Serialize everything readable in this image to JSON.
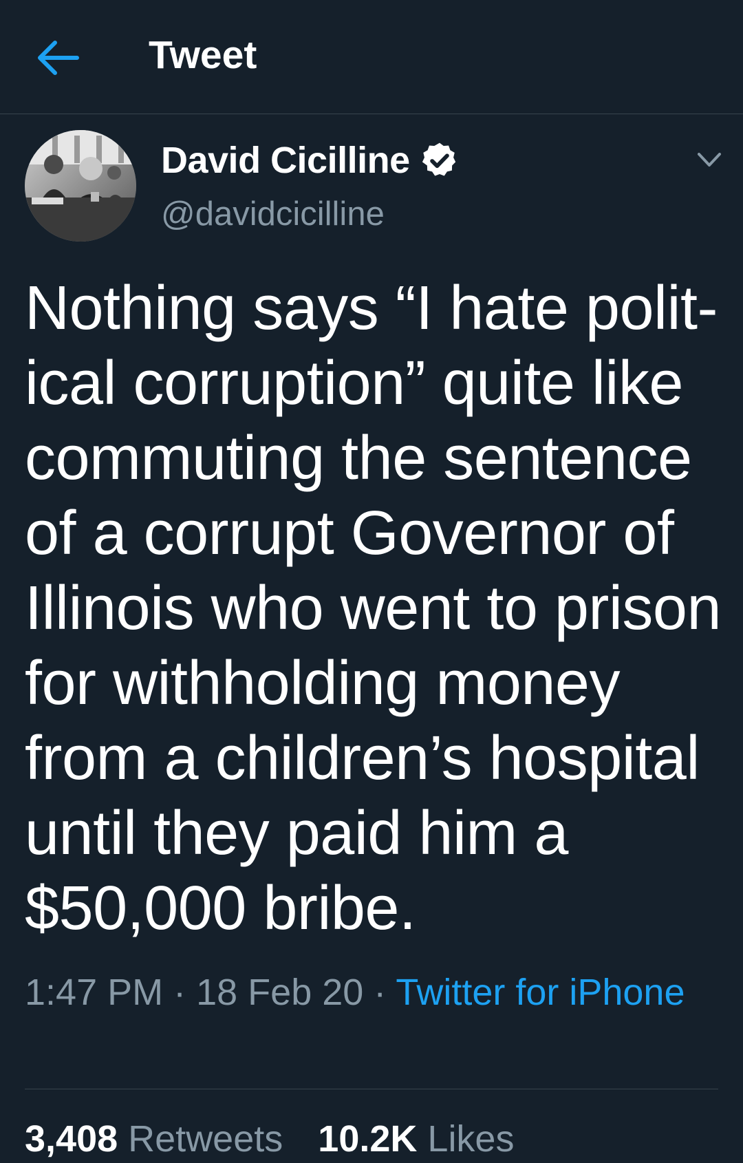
{
  "header": {
    "title": "Tweet",
    "back_icon": "arrow-left-icon"
  },
  "author": {
    "display_name": "David Cicilline",
    "handle": "@davidcicilline",
    "verified": true,
    "avatar_icon": "avatar-photo"
  },
  "tweet": {
    "text": "Nothing says “I hate polit-\nical corruption” quite like\ncommuting the sentence\nof a corrupt Governor of\nIllinois who went to prison\nfor withholding money\nfrom a children’s hospital\nuntil they paid him a\n$50,000 bribe.",
    "time": "1:47 PM",
    "date": "18 Feb 20",
    "separator": " · ",
    "source": "Twitter for iPhone"
  },
  "stats": {
    "retweets_count": "3,408",
    "retweets_label": "Retweets",
    "likes_count": "10.2K",
    "likes_label": "Likes"
  },
  "colors": {
    "background": "#15202b",
    "accent": "#1da1f2",
    "secondary_text": "#8899a6",
    "divider": "#38444d"
  }
}
